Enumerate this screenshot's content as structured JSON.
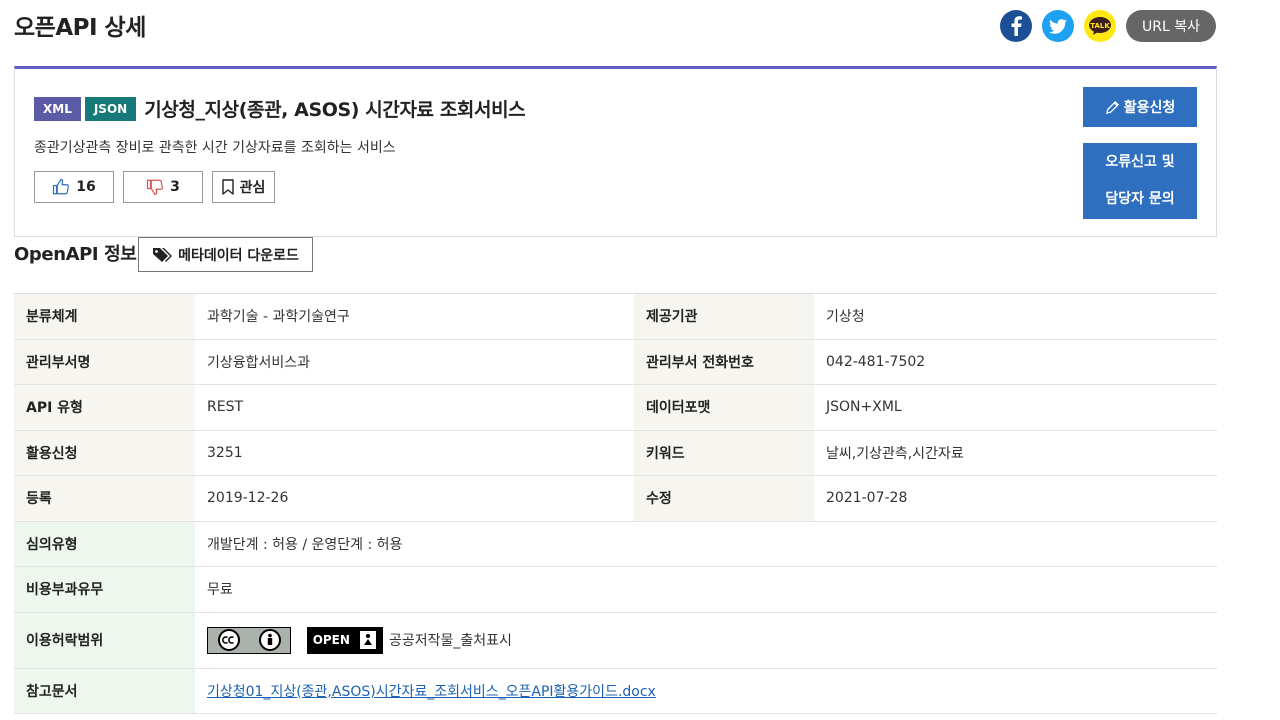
{
  "header": {
    "title": "오픈API 상세",
    "share": {
      "facebook_icon": "facebook-icon",
      "twitter_icon": "twitter-icon",
      "kakao_icon": "kakao-talk-icon",
      "kakao_text": "TALK",
      "url_copy_label": "URL 복사"
    }
  },
  "api": {
    "formats": [
      "XML",
      "JSON"
    ],
    "title": "기상청_지상(종관, ASOS) 시간자료 조회서비스",
    "description": "종관기상관측 장비로 관측한 시간 기상자료를 조회하는 서비스",
    "likes": "16",
    "dislikes": "3",
    "favorite_label": "관심",
    "apply_label": "활용신청",
    "report_label_line1": "오류신고 및",
    "report_label_line2": "담당자 문의"
  },
  "info": {
    "heading": "OpenAPI 정보",
    "metadata_download_label": "메타데이터 다운로드",
    "rows": {
      "category_label": "분류체계",
      "category_value": "과학기술 - 과학기술연구",
      "provider_label": "제공기관",
      "provider_value": "기상청",
      "dept_label": "관리부서명",
      "dept_value": "기상융합서비스과",
      "phone_label": "관리부서 전화번호",
      "phone_value": "042-481-7502",
      "type_label": "API 유형",
      "type_value": "REST",
      "format_label": "데이터포맷",
      "format_value": "JSON+XML",
      "apply_label": "활용신청",
      "apply_value": "3251",
      "keyword_label": "키워드",
      "keyword_value": "날씨,기상관측,시간자료",
      "registered_label": "등록",
      "registered_value": "2019-12-26",
      "modified_label": "수정",
      "modified_value": "2021-07-28",
      "review_label": "심의유형",
      "review_value": "개발단계 : 허용 / 운영단계 : 허용",
      "cost_label": "비용부과유무",
      "cost_value": "무료",
      "license_label": "이용허락범위",
      "license_open_text": "OPEN",
      "license_value": "공공저작물_출처표시",
      "docs_label": "참고문서",
      "docs_value": "기상청01_지상(종관,ASOS)시간자료_조회서비스_오픈API활용가이드.docx"
    }
  },
  "colors": {
    "accent_bar": "#5f5fbf",
    "xml_badge": "#5c5ba8",
    "json_badge": "#177a7a",
    "primary_button": "#2f6fbf",
    "link": "#1a62b5"
  }
}
